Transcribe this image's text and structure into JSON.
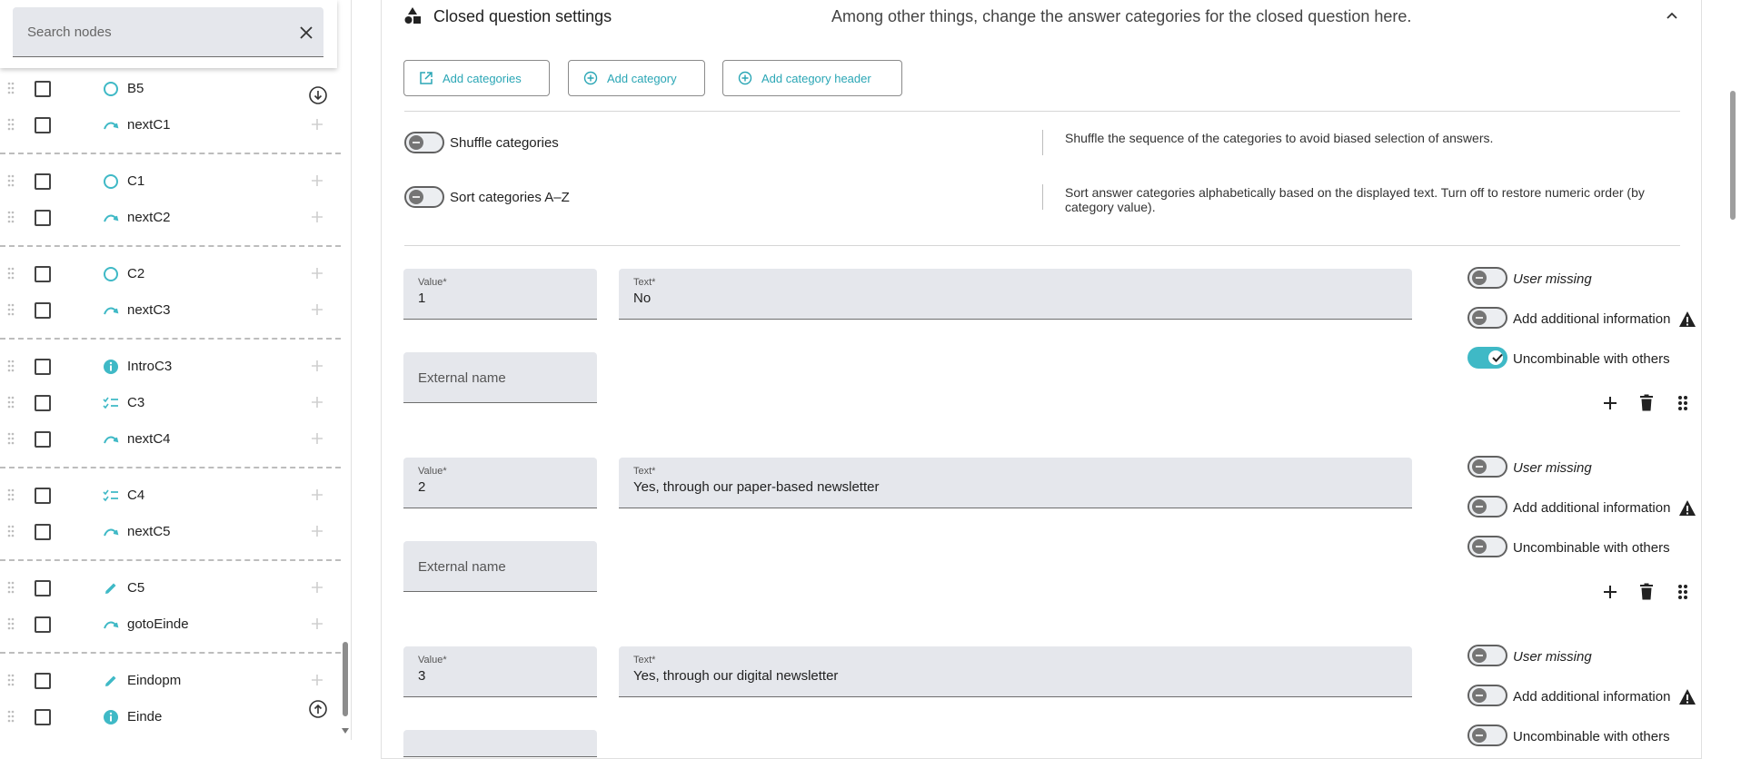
{
  "sidebar": {
    "search": {
      "placeholder": "Search nodes"
    },
    "nodes": [
      {
        "label": "B5",
        "icon": "circle-outline-icon"
      },
      {
        "label": "nextC1",
        "icon": "transition-arrow-icon"
      },
      {
        "label": "C1",
        "icon": "circle-outline-icon"
      },
      {
        "label": "nextC2",
        "icon": "transition-arrow-icon"
      },
      {
        "label": "C2",
        "icon": "circle-outline-icon"
      },
      {
        "label": "nextC3",
        "icon": "transition-arrow-icon"
      },
      {
        "label": "IntroC3",
        "icon": "info-icon"
      },
      {
        "label": "C3",
        "icon": "checklist-icon"
      },
      {
        "label": "nextC4",
        "icon": "transition-arrow-icon"
      },
      {
        "label": "C4",
        "icon": "checklist-icon"
      },
      {
        "label": "nextC5",
        "icon": "transition-arrow-icon"
      },
      {
        "label": "C5",
        "icon": "pencil-icon"
      },
      {
        "label": "gotoEinde",
        "icon": "transition-arrow-icon"
      },
      {
        "label": "Eindopm",
        "icon": "pencil-icon"
      },
      {
        "label": "Einde",
        "icon": "info-icon"
      }
    ]
  },
  "panel": {
    "title": "Closed question settings",
    "description": "Among other things, change the answer categories for the closed question here.",
    "buttons": {
      "add_categories": "Add categories",
      "add_category": "Add category",
      "add_category_header": "Add category header"
    },
    "settings": {
      "shuffle": {
        "label": "Shuffle categories",
        "description": "Shuffle the sequence of the categories to avoid biased selection of answers.",
        "enabled": false
      },
      "sort": {
        "label": "Sort categories A–Z",
        "description": "Sort answer categories alphabetically based on the displayed text. Turn off to restore numeric order (by category value).",
        "enabled": false
      }
    },
    "field_labels": {
      "value": "Value*",
      "text": "Text*",
      "external_name": "External name"
    },
    "option_labels": {
      "user_missing": "User missing",
      "additional_info": "Add additional information",
      "uncombinable": "Uncombinable with others"
    },
    "categories": [
      {
        "value": "1",
        "text": "No",
        "user_missing": false,
        "additional_info": false,
        "uncombinable": true
      },
      {
        "value": "2",
        "text": "Yes, through our paper-based newsletter",
        "user_missing": false,
        "additional_info": false,
        "uncombinable": false
      },
      {
        "value": "3",
        "text": "Yes, through our digital newsletter",
        "user_missing": false,
        "additional_info": false,
        "uncombinable": false
      }
    ]
  },
  "colors": {
    "accent": "#3fb9c6",
    "link": "#2aa6b5",
    "field_bg": "#e5e7ec"
  }
}
